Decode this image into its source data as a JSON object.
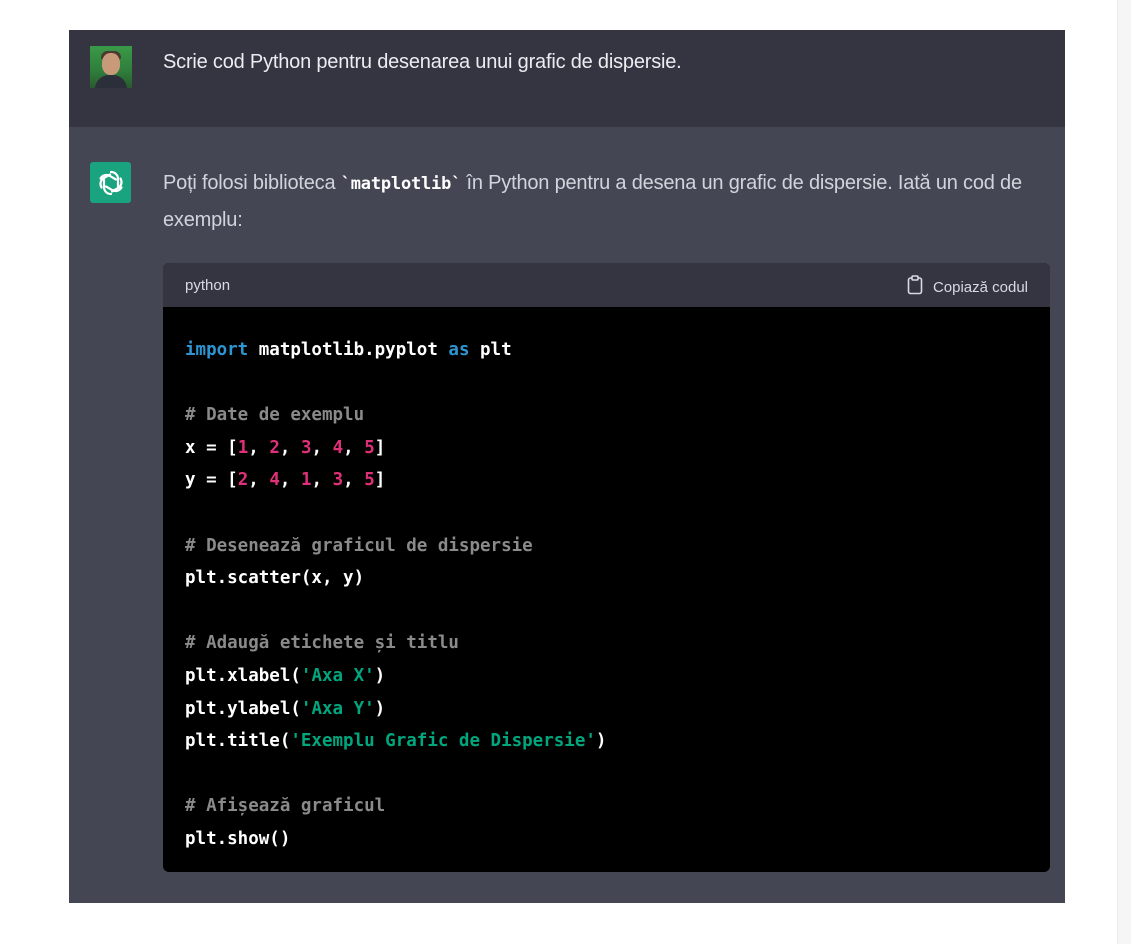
{
  "user_message": "Scrie cod Python pentru desenarea unui grafic de dispersie.",
  "assistant": {
    "text_before": "Poți folosi biblioteca ",
    "inline_code": "`matplotlib`",
    "text_after": " în Python pentru a desena un grafic de dispersie. Iată un cod de exemplu:"
  },
  "code_block": {
    "language": "python",
    "copy_label": "Copiază codul",
    "lines": {
      "l1": {
        "kw1": "import",
        "a": " matplotlib.pyplot ",
        "kw2": "as",
        "b": " plt"
      },
      "l2": {
        "comment": "# Date de exemplu"
      },
      "l3": {
        "prefix": "x = [",
        "n1": "1",
        "n2": "2",
        "n3": "3",
        "n4": "4",
        "n5": "5",
        "sep": ", ",
        "suffix": "]"
      },
      "l4": {
        "prefix": "y = [",
        "n1": "2",
        "n2": "4",
        "n3": "1",
        "n4": "3",
        "n5": "5",
        "sep": ", ",
        "suffix": "]"
      },
      "l5": {
        "comment": "# Desenează graficul de dispersie"
      },
      "l6": {
        "text": "plt.scatter(x, y)"
      },
      "l7": {
        "comment": "# Adaugă etichete și titlu"
      },
      "l8": {
        "pre": "plt.xlabel(",
        "str": "'Axa X'",
        "post": ")"
      },
      "l9": {
        "pre": "plt.ylabel(",
        "str": "'Axa Y'",
        "post": ")"
      },
      "l10": {
        "pre": "plt.title(",
        "str": "'Exemplu Grafic de Dispersie'",
        "post": ")"
      },
      "l11": {
        "comment": "# Afișează graficul"
      },
      "l12": {
        "text": "plt.show()"
      }
    }
  },
  "colors": {
    "page_bg": "#ffffff",
    "user_row_bg": "#343541",
    "assistant_row_bg": "#444654",
    "code_bg": "#000000",
    "code_header_bg": "#343541",
    "keyword": "#2e95d3",
    "number": "#df3079",
    "string": "#00a67d",
    "comment": "#8a8a8a",
    "bot_icon_bg": "#19a37f"
  },
  "icons": {
    "avatar": "user-avatar",
    "bot": "openai-logo-icon",
    "copy": "clipboard-icon"
  }
}
